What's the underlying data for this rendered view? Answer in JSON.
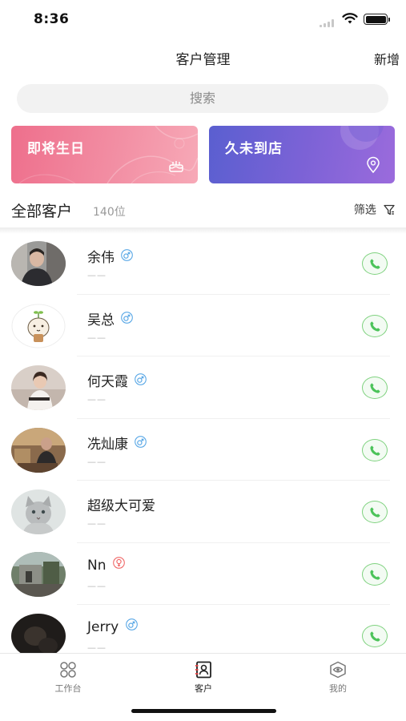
{
  "status_bar": {
    "time": "8:36"
  },
  "nav": {
    "title": "客户管理",
    "add_label": "新增"
  },
  "search": {
    "placeholder": "搜索"
  },
  "cards": [
    {
      "label": "即将生日",
      "icon": "cake-icon",
      "color": "#ee6f8c"
    },
    {
      "label": "久未到店",
      "icon": "location-pin-icon",
      "color": "#6a60d4"
    }
  ],
  "customers_header": {
    "title": "全部客户",
    "count": "140位",
    "filter_label": "筛选"
  },
  "customers": [
    {
      "name": "余伟",
      "gender": "male",
      "sub": "——",
      "avatar": "avatar-photo-man"
    },
    {
      "name": "吴总",
      "gender": "male",
      "sub": "——",
      "avatar": "avatar-cartoon-sprout"
    },
    {
      "name": "何天霞",
      "gender": "male",
      "sub": "——",
      "avatar": "avatar-photo-woman"
    },
    {
      "name": "冼灿康",
      "gender": "male",
      "sub": "——",
      "avatar": "avatar-photo-room"
    },
    {
      "name": "超级大可爱",
      "gender": "none",
      "sub": "——",
      "avatar": "avatar-photo-cat"
    },
    {
      "name": "Nn",
      "gender": "female",
      "sub": "——",
      "avatar": "avatar-photo-street"
    },
    {
      "name": "Jerry",
      "gender": "male",
      "sub": "——",
      "avatar": "avatar-photo-dark"
    }
  ],
  "tabs": [
    {
      "label": "工作台",
      "icon": "grid-icon",
      "active": false
    },
    {
      "label": "客户",
      "icon": "contact-card-icon",
      "active": true
    },
    {
      "label": "我的",
      "icon": "eye-icon",
      "active": false
    }
  ],
  "colors": {
    "male": "#5aa8e6",
    "female": "#f06a6a",
    "call_green": "#4cc35a"
  }
}
